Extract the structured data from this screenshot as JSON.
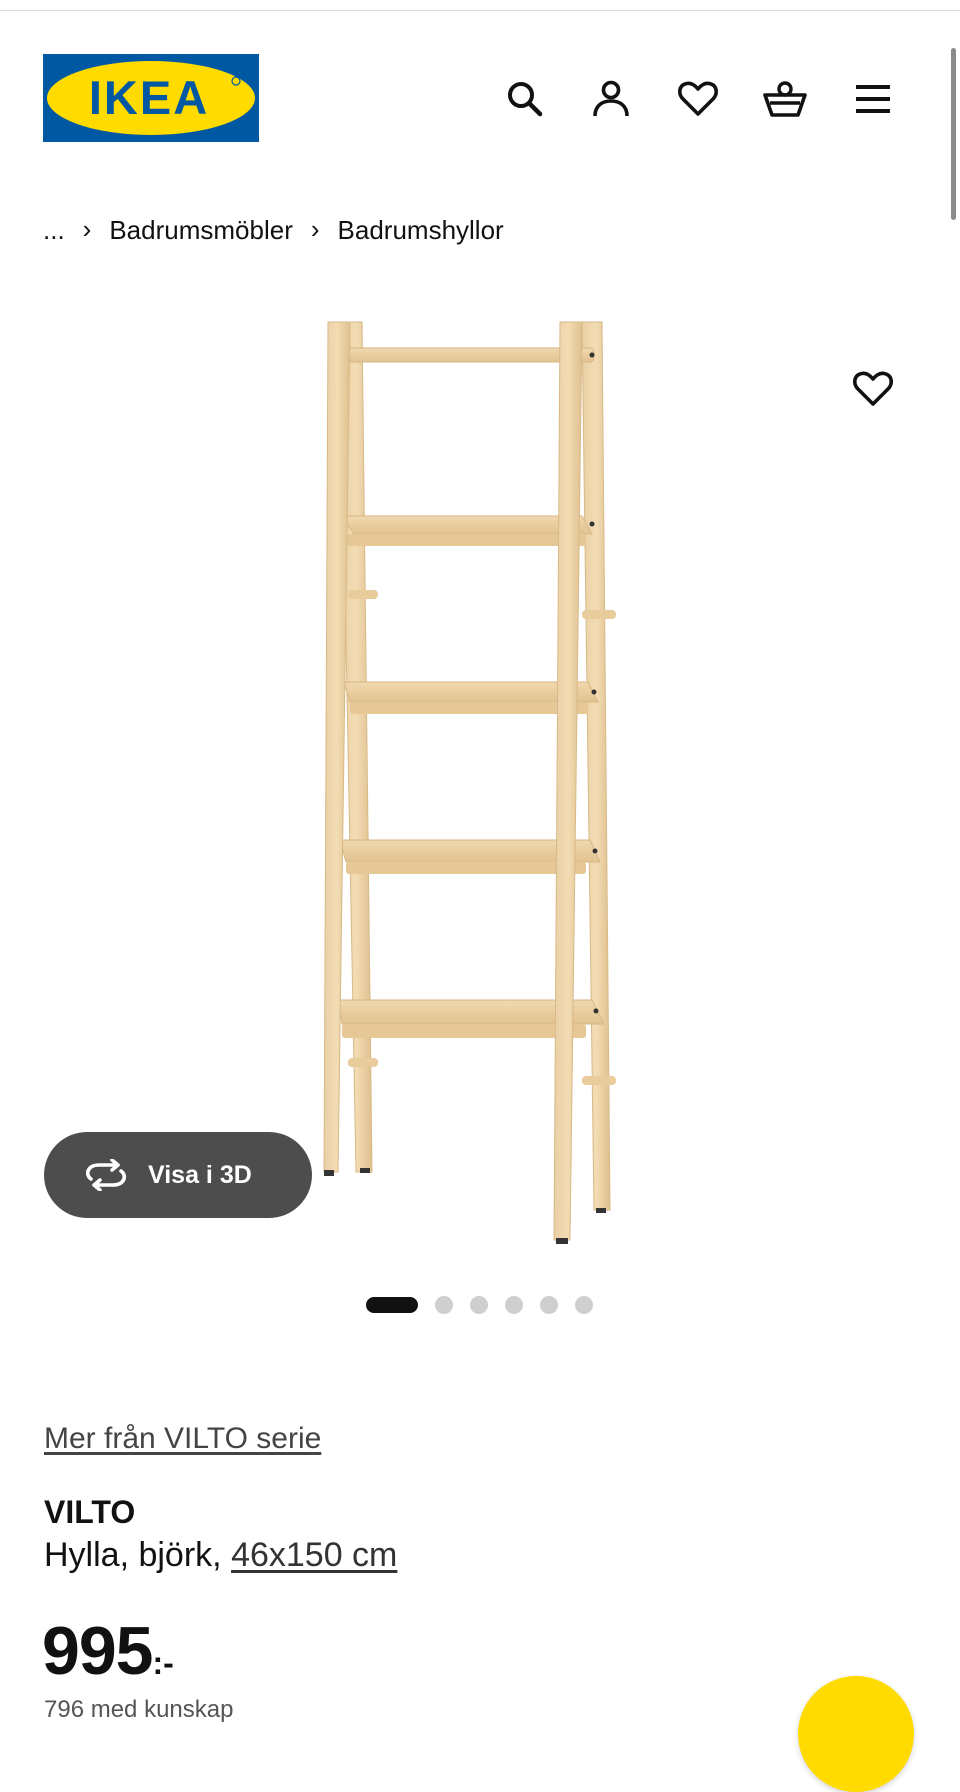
{
  "header": {
    "logo_text": "IKEA",
    "colors": {
      "logo_blue": "#0058a3",
      "logo_yellow": "#ffdb00"
    },
    "icons": [
      "search-icon",
      "account-icon",
      "heart-icon",
      "basket-icon",
      "menu-icon"
    ]
  },
  "breadcrumb": {
    "ellipsis": "...",
    "items": [
      "Badrumsmöbler",
      "Badrumshyllor"
    ]
  },
  "gallery": {
    "view_3d_label": "Visa i 3D",
    "favorite_icon": "heart-icon",
    "slide_count": 6,
    "active_slide": 1
  },
  "product": {
    "series_link": "Mer från VILTO serie",
    "name": "VILTO",
    "description": "Hylla, björk, ",
    "dimensions": "46x150 cm",
    "price": "995",
    "price_suffix": ":-",
    "sub_price": "796 med kunskap"
  }
}
